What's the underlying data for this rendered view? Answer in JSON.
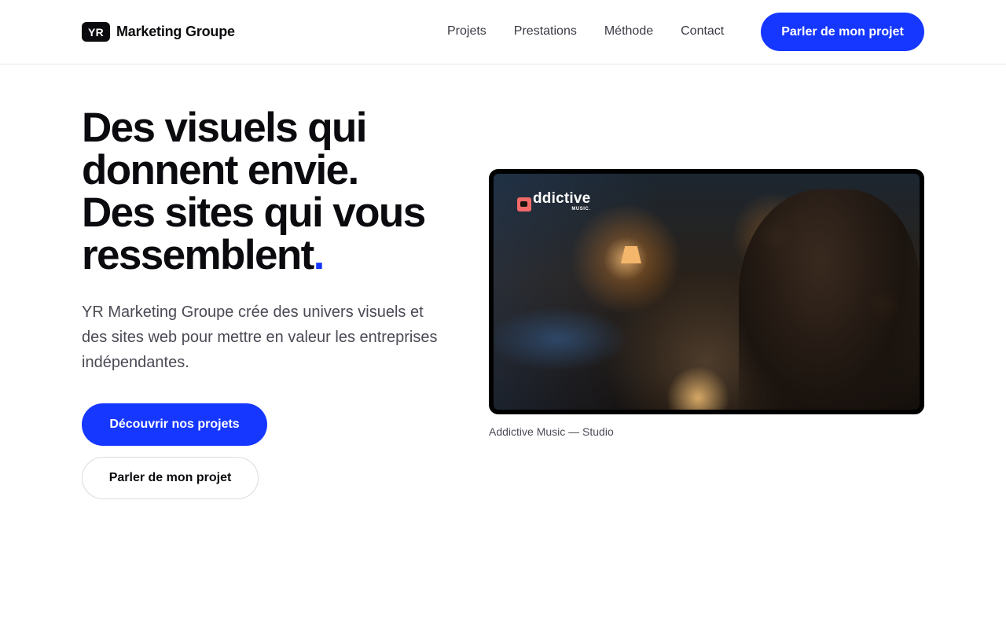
{
  "header": {
    "logo_badge": "YR",
    "logo_name": "Marketing Groupe",
    "nav": [
      "Projets",
      "Prestations",
      "Méthode",
      "Contact"
    ],
    "cta_label": "Parler de mon projet"
  },
  "hero": {
    "title_lines": [
      "Des visuels qui",
      "donnent envie.",
      "Des sites qui vous",
      "ressemblent"
    ],
    "title_dot": ".",
    "subtitle": "YR Marketing Groupe crée des univers visuels et des sites web pour mettre en valeur les entreprises indépendantes.",
    "primary_cta": "Découvrir nos projets",
    "secondary_cta": "Parler de mon projet"
  },
  "media": {
    "brand_name": "ddictive",
    "brand_sub": "MUSIC.",
    "caption": "Addictive Music — Studio"
  },
  "colors": {
    "accent": "#1637ff",
    "text": "#0b0b0f",
    "muted": "#4a4a55",
    "brand_mark": "#f06a6a"
  }
}
